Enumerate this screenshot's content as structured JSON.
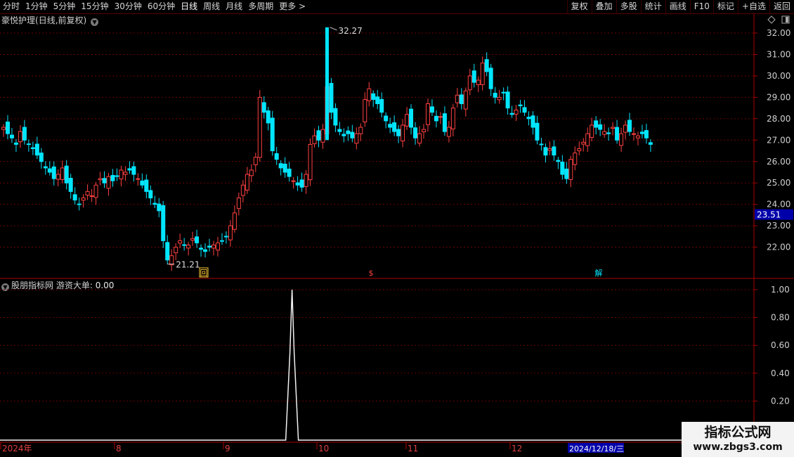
{
  "toolbar": {
    "periods": [
      "分时",
      "1分钟",
      "5分钟",
      "15分钟",
      "30分钟",
      "60分钟",
      "日线",
      "周线",
      "月线",
      "多周期",
      "更多 >"
    ],
    "active_period": "日线",
    "right_buttons": [
      "复权",
      "叠加",
      "多股",
      "统计",
      "画线",
      "F10",
      "标记",
      "+自选",
      "返回"
    ]
  },
  "main_chart": {
    "stock_name": "豪悦护理",
    "mode": "(日线,前复权)",
    "y_ticks": [
      "32.00",
      "31.00",
      "30.00",
      "29.00",
      "28.00",
      "27.00",
      "26.00",
      "25.00",
      "24.00",
      "23.00",
      "22.00"
    ],
    "current_price": "23.51",
    "high_label": "32.27",
    "low_label": "21.21",
    "markers": [
      "回",
      "$",
      "解"
    ],
    "colors": {
      "up": "#ff4040",
      "down": "#00e6ff",
      "grid": "#6a0000",
      "border": "#aa0000",
      "price_box": "#0000aa"
    }
  },
  "sub_chart": {
    "indicator_name": "股朋指标网",
    "series_label": "游资大单:",
    "series_value": "0.00",
    "y_ticks": [
      "1.00",
      "0.80",
      "0.60",
      "0.40",
      "0.20"
    ]
  },
  "x_axis": {
    "labels": [
      "2024年",
      "8",
      "9",
      "10",
      "11",
      "12"
    ],
    "cursor_date": "2024/12/18/三"
  },
  "watermark": {
    "line1": "指标公式网",
    "line2": "www.zbgs3.com"
  },
  "chart_data": {
    "type": "candlestick",
    "title": "豪悦护理(日线,前复权)",
    "ylim": [
      21.0,
      32.3
    ],
    "high": 32.27,
    "low": 21.21,
    "last": 23.51,
    "closes": [
      27.6,
      27.3,
      27.1,
      26.8,
      27.4,
      27.0,
      26.8,
      26.6,
      26.3,
      26.0,
      25.7,
      25.5,
      25.2,
      25.4,
      25.7,
      25.0,
      24.6,
      24.2,
      24.0,
      24.3,
      24.6,
      24.4,
      24.9,
      25.2,
      25.0,
      25.3,
      25.1,
      25.3,
      25.6,
      25.5,
      25.6,
      25.4,
      25.2,
      24.9,
      24.6,
      24.3,
      24.0,
      23.7,
      22.3,
      21.4,
      21.6,
      22.0,
      22.3,
      22.1,
      22.1,
      22.4,
      22.2,
      21.9,
      21.8,
      22.0,
      22.1,
      22.2,
      22.3,
      22.5,
      23.0,
      23.6,
      24.3,
      24.9,
      25.4,
      25.6,
      26.2,
      29.0,
      28.3,
      27.8,
      26.5,
      26.1,
      25.7,
      25.5,
      25.3,
      25.1,
      24.9,
      24.8,
      25.4,
      26.8,
      27.2,
      27.0,
      27.5,
      29.5,
      28.3,
      27.7,
      27.4,
      27.2,
      27.3,
      27.1,
      27.3,
      27.6,
      28.9,
      29.4,
      28.9,
      28.7,
      28.3,
      27.9,
      27.6,
      27.4,
      27.2,
      27.7,
      28.2,
      27.6,
      27.1,
      27.3,
      27.5,
      28.7,
      28.3,
      27.9,
      28.1,
      27.4,
      27.6,
      28.5,
      29.1,
      28.7,
      29.3,
      30.0,
      29.7,
      29.8,
      30.6,
      30.2,
      29.4,
      29.0,
      29.0,
      29.2,
      28.5,
      28.2,
      28.4,
      28.6,
      28.3,
      28.0,
      27.6,
      27.0,
      26.8,
      26.3,
      26.6,
      26.3,
      26.0,
      25.4,
      25.2,
      26.1,
      26.4,
      26.6,
      26.9,
      27.3,
      27.7,
      27.6,
      27.5,
      27.4,
      27.3,
      27.6,
      27.0,
      27.3,
      27.7,
      27.4,
      27.3,
      27.2,
      27.3,
      27.1,
      26.8
    ],
    "sub_series": {
      "name": "游资大单",
      "peak_value": 1.0,
      "peak_at_candle": 68,
      "ylim": [
        0,
        1.05
      ]
    }
  }
}
